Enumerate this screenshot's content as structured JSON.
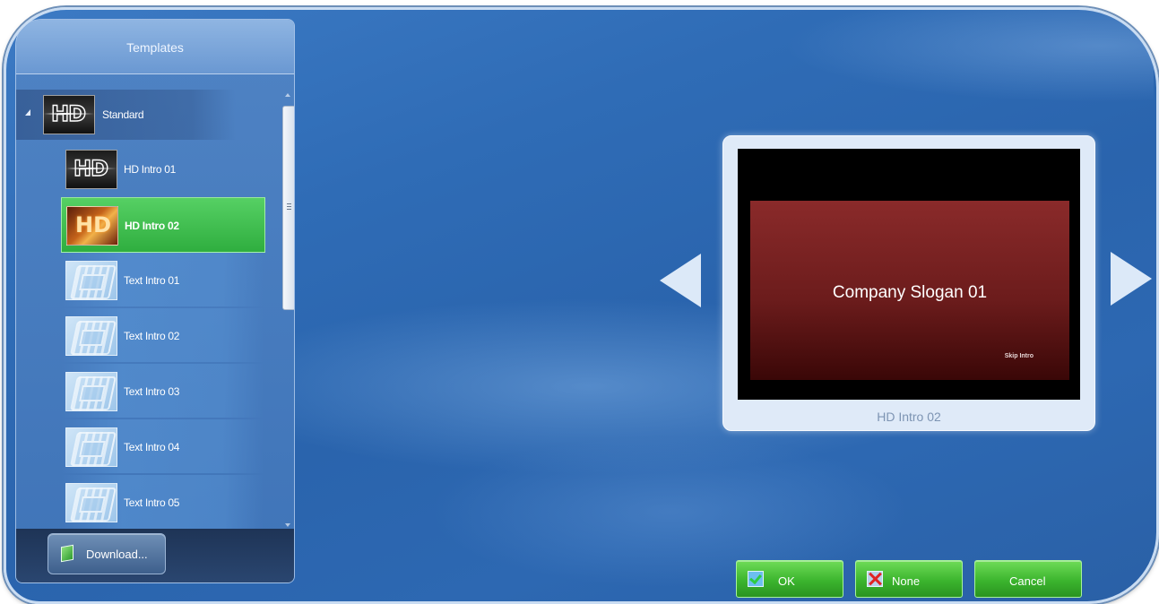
{
  "panel": {
    "header": "Templates",
    "group": {
      "label": "Standard",
      "thumb": "HD"
    },
    "items": [
      {
        "label": "HD Intro 01",
        "thumb": "HD",
        "selected": false
      },
      {
        "label": "HD Intro 02",
        "thumb": "HD",
        "selected": true
      },
      {
        "label": "Text Intro 01",
        "thumb": "film-icon",
        "selected": false
      },
      {
        "label": "Text Intro 02",
        "thumb": "film-icon",
        "selected": false
      },
      {
        "label": "Text Intro 03",
        "thumb": "film-icon",
        "selected": false
      },
      {
        "label": "Text Intro 04",
        "thumb": "film-icon",
        "selected": false
      },
      {
        "label": "Text Intro 05",
        "thumb": "film-icon",
        "selected": false
      }
    ],
    "download_label": "Download..."
  },
  "preview": {
    "slogan": "Company Slogan 01",
    "skip": "Skip Intro",
    "caption": "HD Intro 02"
  },
  "buttons": {
    "ok": "OK",
    "none": "None",
    "cancel": "Cancel"
  },
  "colors": {
    "selected_row": "#3fbf4f",
    "button_green": "#3cb52e",
    "background_blue": "#2f6cb6"
  }
}
